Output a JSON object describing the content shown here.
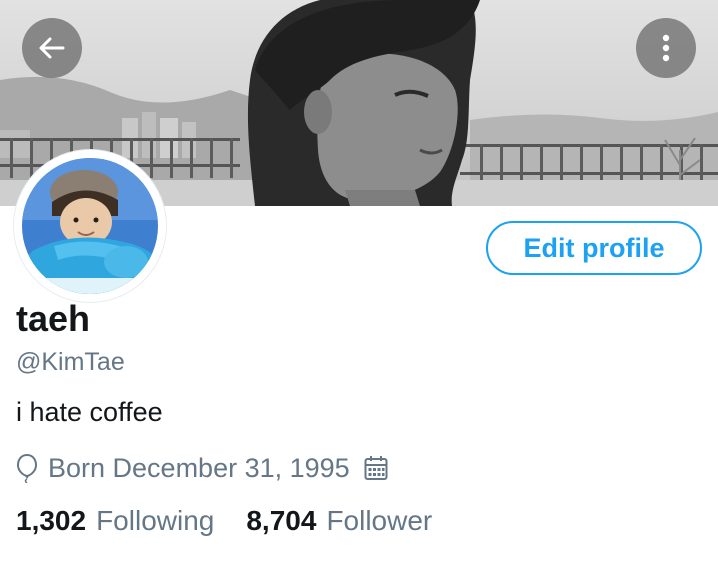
{
  "header": {
    "back_icon": "arrow-left-icon",
    "more_icon": "vertical-dots-icon"
  },
  "profile": {
    "edit_label": "Edit profile",
    "display_name": "taeh",
    "handle": "@KimTae",
    "bio": "i hate coffee",
    "birth_icon": "balloon-icon",
    "birth_text": "Born December 31, 1995",
    "calendar_icon": "calendar-icon"
  },
  "stats": {
    "following_count": "1,302",
    "following_label": "Following",
    "follower_count": "8,704",
    "follower_label": "Follower"
  },
  "colors": {
    "accent": "#1da1f2",
    "primary_text": "#14171a",
    "secondary_text": "#657786"
  }
}
